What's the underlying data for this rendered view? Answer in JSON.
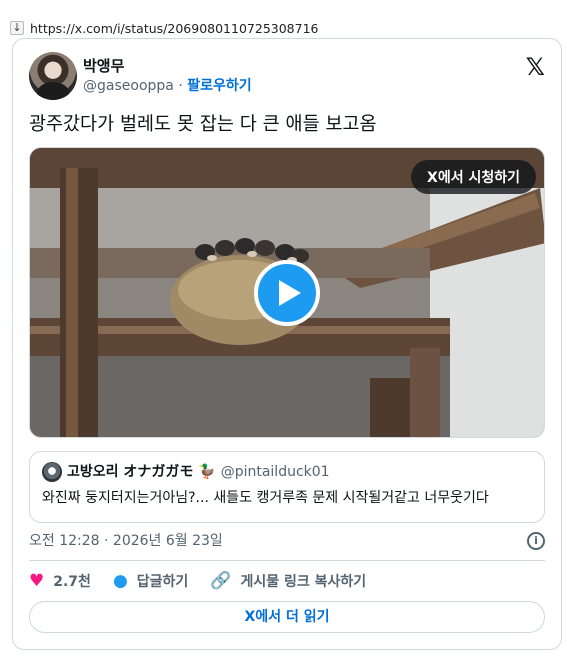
{
  "browser": {
    "url": "https://x.com/i/status/2069080110725308716",
    "download_icon": "download-arrow-icon"
  },
  "tweet": {
    "author": {
      "display_name": "박앵무",
      "handle": "@gaseooppa",
      "separator": "·",
      "follow_label": "팔로우하기"
    },
    "brand_icon": "x-logo-icon",
    "text": "광주갔다가 벌레도 못 잡는 다 큰 애들 보고옴",
    "media": {
      "watch_label": "X에서 시청하기",
      "play_icon": "play-icon"
    },
    "quote": {
      "display_name": "고방오리 オナガガモ 🦆",
      "handle": "@pintailduck01",
      "text": "와진짜 둥지터지는거아님?... 새들도 캥거루족 문제 시작될거같고 너무웃기다"
    },
    "timestamp": "오전 12:28 · 2026년 6월 23일",
    "info_icon": "info-icon",
    "actions": {
      "like_count": "2.7천",
      "reply_label": "답글하기",
      "copy_link_label": "게시물 링크 복사하기"
    },
    "read_more_label": "X에서 더 읽기"
  },
  "colors": {
    "link_blue": "#006fd6",
    "brand_blue": "#1d9bf0",
    "like_pink": "#f91880",
    "muted_text": "#536471",
    "border": "#cfd9de"
  }
}
